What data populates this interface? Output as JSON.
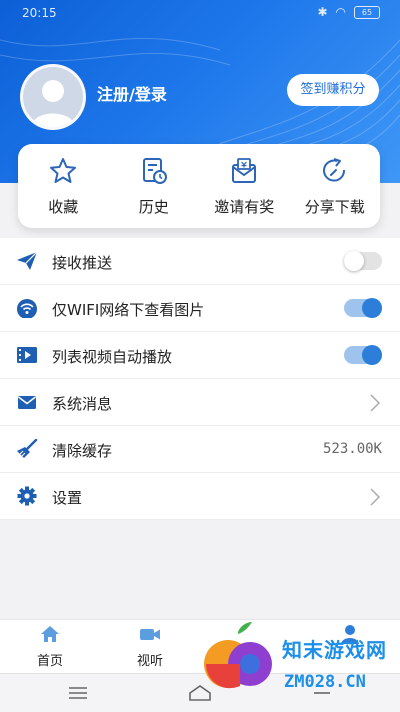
{
  "status_bar": {
    "time": "20:15",
    "battery": "65"
  },
  "profile": {
    "login_label": "注册/登录",
    "checkin_button": "签到赚积分"
  },
  "quick_actions": [
    {
      "label": "收藏",
      "icon": "star-icon"
    },
    {
      "label": "历史",
      "icon": "history-icon"
    },
    {
      "label": "邀请有奖",
      "icon": "invite-icon"
    },
    {
      "label": "分享下载",
      "icon": "share-icon"
    }
  ],
  "settings": [
    {
      "label": "接收推送",
      "icon": "send-icon",
      "control": "toggle",
      "on": false
    },
    {
      "label": "仅WIFI网络下查看图片",
      "icon": "wifi-icon",
      "control": "toggle",
      "on": true
    },
    {
      "label": "列表视频自动播放",
      "icon": "video-icon",
      "control": "toggle",
      "on": true
    },
    {
      "label": "系统消息",
      "icon": "mail-icon",
      "control": "chevron"
    },
    {
      "label": "清除缓存",
      "icon": "broom-icon",
      "control": "value",
      "value": "523.00K"
    },
    {
      "label": "设置",
      "icon": "gear-icon",
      "control": "chevron"
    }
  ],
  "tabbar": {
    "home": "首页",
    "video": "视听"
  },
  "watermark": {
    "name": "知末游戏网",
    "domain": "ZM028.CN"
  },
  "colors": {
    "accent": "#2d7ed8",
    "header": "#1d77ea"
  }
}
